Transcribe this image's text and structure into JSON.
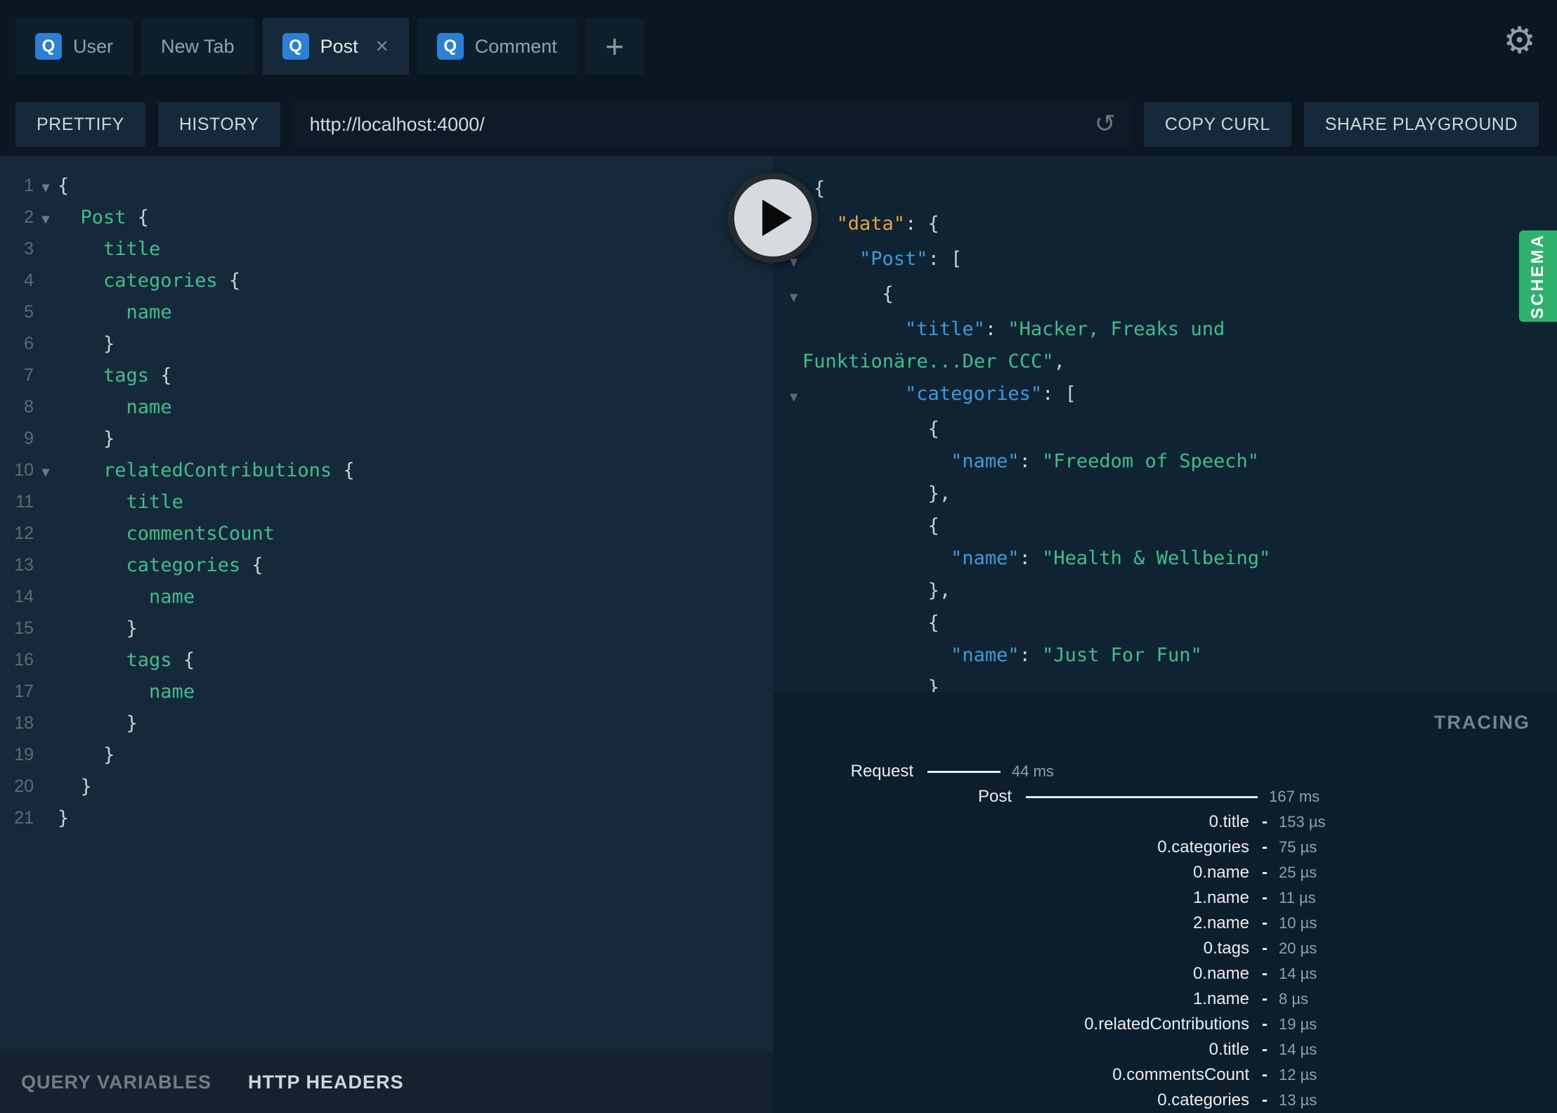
{
  "icons": {
    "settings": "⚙",
    "reload": "↺",
    "close": "✕",
    "add_tab": "+",
    "fold": "▼",
    "dash": "-"
  },
  "colors": {
    "accent_green": "#2fb26e",
    "badge_blue": "#2d7fd4",
    "code_green": "#41bd8c",
    "key_blue": "#3e9bd6",
    "key_orange": "#e9a13e",
    "editor_bg": "#16293a",
    "response_bg": "#0f2333",
    "tracing_bg": "#0c1d2b"
  },
  "tabs": [
    {
      "label": "User",
      "badge": "Q",
      "active": false,
      "closable": false
    },
    {
      "label": "New Tab",
      "badge": null,
      "active": false,
      "closable": false
    },
    {
      "label": "Post",
      "badge": "Q",
      "active": true,
      "closable": true
    },
    {
      "label": "Comment",
      "badge": "Q",
      "active": false,
      "closable": false
    }
  ],
  "toolbar": {
    "prettify": "PRETTIFY",
    "history": "HISTORY",
    "url": "http://localhost:4000/",
    "copy_curl": "COPY CURL",
    "share_playground": "SHARE PLAYGROUND"
  },
  "editor": {
    "lines": [
      {
        "n": 1,
        "fold": true,
        "segs": [
          [
            "p",
            "{"
          ]
        ]
      },
      {
        "n": 2,
        "fold": true,
        "segs": [
          [
            "p",
            "  "
          ],
          [
            "f",
            "Post"
          ],
          [
            "p",
            " {"
          ]
        ]
      },
      {
        "n": 3,
        "fold": false,
        "segs": [
          [
            "p",
            "    "
          ],
          [
            "f",
            "title"
          ]
        ]
      },
      {
        "n": 4,
        "fold": false,
        "segs": [
          [
            "p",
            "    "
          ],
          [
            "f",
            "categories"
          ],
          [
            "p",
            " {"
          ]
        ]
      },
      {
        "n": 5,
        "fold": false,
        "segs": [
          [
            "p",
            "      "
          ],
          [
            "f",
            "name"
          ]
        ]
      },
      {
        "n": 6,
        "fold": false,
        "segs": [
          [
            "p",
            "    }"
          ]
        ]
      },
      {
        "n": 7,
        "fold": false,
        "segs": [
          [
            "p",
            "    "
          ],
          [
            "f",
            "tags"
          ],
          [
            "p",
            " {"
          ]
        ]
      },
      {
        "n": 8,
        "fold": false,
        "segs": [
          [
            "p",
            "      "
          ],
          [
            "f",
            "name"
          ]
        ]
      },
      {
        "n": 9,
        "fold": false,
        "segs": [
          [
            "p",
            "    }"
          ]
        ]
      },
      {
        "n": 10,
        "fold": true,
        "segs": [
          [
            "p",
            "    "
          ],
          [
            "f",
            "relatedContributions"
          ],
          [
            "p",
            " {"
          ]
        ]
      },
      {
        "n": 11,
        "fold": false,
        "segs": [
          [
            "p",
            "      "
          ],
          [
            "f",
            "title"
          ]
        ]
      },
      {
        "n": 12,
        "fold": false,
        "segs": [
          [
            "p",
            "      "
          ],
          [
            "f",
            "commentsCount"
          ]
        ]
      },
      {
        "n": 13,
        "fold": false,
        "segs": [
          [
            "p",
            "      "
          ],
          [
            "f",
            "categories"
          ],
          [
            "p",
            " {"
          ]
        ]
      },
      {
        "n": 14,
        "fold": false,
        "segs": [
          [
            "p",
            "        "
          ],
          [
            "f",
            "name"
          ]
        ]
      },
      {
        "n": 15,
        "fold": false,
        "segs": [
          [
            "p",
            "      }"
          ]
        ]
      },
      {
        "n": 16,
        "fold": false,
        "segs": [
          [
            "p",
            "      "
          ],
          [
            "f",
            "tags"
          ],
          [
            "p",
            " {"
          ]
        ]
      },
      {
        "n": 17,
        "fold": false,
        "segs": [
          [
            "p",
            "        "
          ],
          [
            "f",
            "name"
          ]
        ]
      },
      {
        "n": 18,
        "fold": false,
        "segs": [
          [
            "p",
            "      }"
          ]
        ]
      },
      {
        "n": 19,
        "fold": false,
        "segs": [
          [
            "p",
            "    }"
          ]
        ]
      },
      {
        "n": 20,
        "fold": false,
        "segs": [
          [
            "p",
            "  }"
          ]
        ]
      },
      {
        "n": 21,
        "fold": false,
        "segs": [
          [
            "p",
            "}"
          ]
        ]
      }
    ]
  },
  "response": {
    "lines": [
      {
        "fold": true,
        "outdent": false,
        "segs": [
          [
            "p",
            "{"
          ]
        ]
      },
      {
        "fold": true,
        "outdent": false,
        "segs": [
          [
            "p",
            "  "
          ],
          [
            "d",
            "\"data\""
          ],
          [
            "p",
            ": {"
          ]
        ]
      },
      {
        "fold": true,
        "outdent": false,
        "segs": [
          [
            "p",
            "    "
          ],
          [
            "k",
            "\"Post\""
          ],
          [
            "p",
            ": ["
          ]
        ]
      },
      {
        "fold": true,
        "outdent": false,
        "segs": [
          [
            "p",
            "      {"
          ]
        ]
      },
      {
        "fold": false,
        "outdent": false,
        "segs": [
          [
            "p",
            "        "
          ],
          [
            "k",
            "\"title\""
          ],
          [
            "p",
            ": "
          ],
          [
            "s",
            "\"Hacker, Freaks und"
          ]
        ]
      },
      {
        "fold": false,
        "outdent": true,
        "segs": [
          [
            "s",
            "Funktionäre...Der CCC\""
          ],
          [
            "p",
            ","
          ]
        ]
      },
      {
        "fold": true,
        "outdent": false,
        "segs": [
          [
            "p",
            "        "
          ],
          [
            "k",
            "\"categories\""
          ],
          [
            "p",
            ": ["
          ]
        ]
      },
      {
        "fold": false,
        "outdent": false,
        "segs": [
          [
            "p",
            "          {"
          ]
        ]
      },
      {
        "fold": false,
        "outdent": false,
        "segs": [
          [
            "p",
            "            "
          ],
          [
            "k",
            "\"name\""
          ],
          [
            "p",
            ": "
          ],
          [
            "s",
            "\"Freedom of Speech\""
          ]
        ]
      },
      {
        "fold": false,
        "outdent": false,
        "segs": [
          [
            "p",
            "          },"
          ]
        ]
      },
      {
        "fold": false,
        "outdent": false,
        "segs": [
          [
            "p",
            "          {"
          ]
        ]
      },
      {
        "fold": false,
        "outdent": false,
        "segs": [
          [
            "p",
            "            "
          ],
          [
            "k",
            "\"name\""
          ],
          [
            "p",
            ": "
          ],
          [
            "s",
            "\"Health & Wellbeing\""
          ]
        ]
      },
      {
        "fold": false,
        "outdent": false,
        "segs": [
          [
            "p",
            "          },"
          ]
        ]
      },
      {
        "fold": false,
        "outdent": false,
        "segs": [
          [
            "p",
            "          {"
          ]
        ]
      },
      {
        "fold": false,
        "outdent": false,
        "segs": [
          [
            "p",
            "            "
          ],
          [
            "k",
            "\"name\""
          ],
          [
            "p",
            ": "
          ],
          [
            "s",
            "\"Just For Fun\""
          ]
        ]
      },
      {
        "fold": false,
        "outdent": false,
        "segs": [
          [
            "p",
            "          }"
          ]
        ]
      },
      {
        "fold": false,
        "outdent": false,
        "segs": [
          [
            "p",
            "        ]"
          ]
        ]
      }
    ]
  },
  "schema_tab": "SCHEMA",
  "tracing": {
    "title": "TRACING",
    "rows": [
      {
        "label": "Request",
        "time": "44 ms",
        "bar": 104,
        "labelW": 160
      },
      {
        "label": "Post",
        "time": "167 ms",
        "bar": 330,
        "labelW": 300
      },
      {
        "label": "0.title",
        "time": "153 µs",
        "bar": 0,
        "labelW": 638
      },
      {
        "label": "0.categories",
        "time": "75 µs",
        "bar": 0,
        "labelW": 638
      },
      {
        "label": "0.name",
        "time": "25 µs",
        "bar": 0,
        "labelW": 638
      },
      {
        "label": "1.name",
        "time": "11 µs",
        "bar": 0,
        "labelW": 638
      },
      {
        "label": "2.name",
        "time": "10 µs",
        "bar": 0,
        "labelW": 638
      },
      {
        "label": "0.tags",
        "time": "20 µs",
        "bar": 0,
        "labelW": 638
      },
      {
        "label": "0.name",
        "time": "14 µs",
        "bar": 0,
        "labelW": 638
      },
      {
        "label": "1.name",
        "time": "8 µs",
        "bar": 0,
        "labelW": 638
      },
      {
        "label": "0.relatedContributions",
        "time": "19 µs",
        "bar": 0,
        "labelW": 638
      },
      {
        "label": "0.title",
        "time": "14 µs",
        "bar": 0,
        "labelW": 638
      },
      {
        "label": "0.commentsCount",
        "time": "12 µs",
        "bar": 0,
        "labelW": 638
      },
      {
        "label": "0.categories",
        "time": "13 µs",
        "bar": 0,
        "labelW": 638
      }
    ]
  },
  "footer": {
    "query_variables": "QUERY VARIABLES",
    "http_headers": "HTTP HEADERS"
  }
}
